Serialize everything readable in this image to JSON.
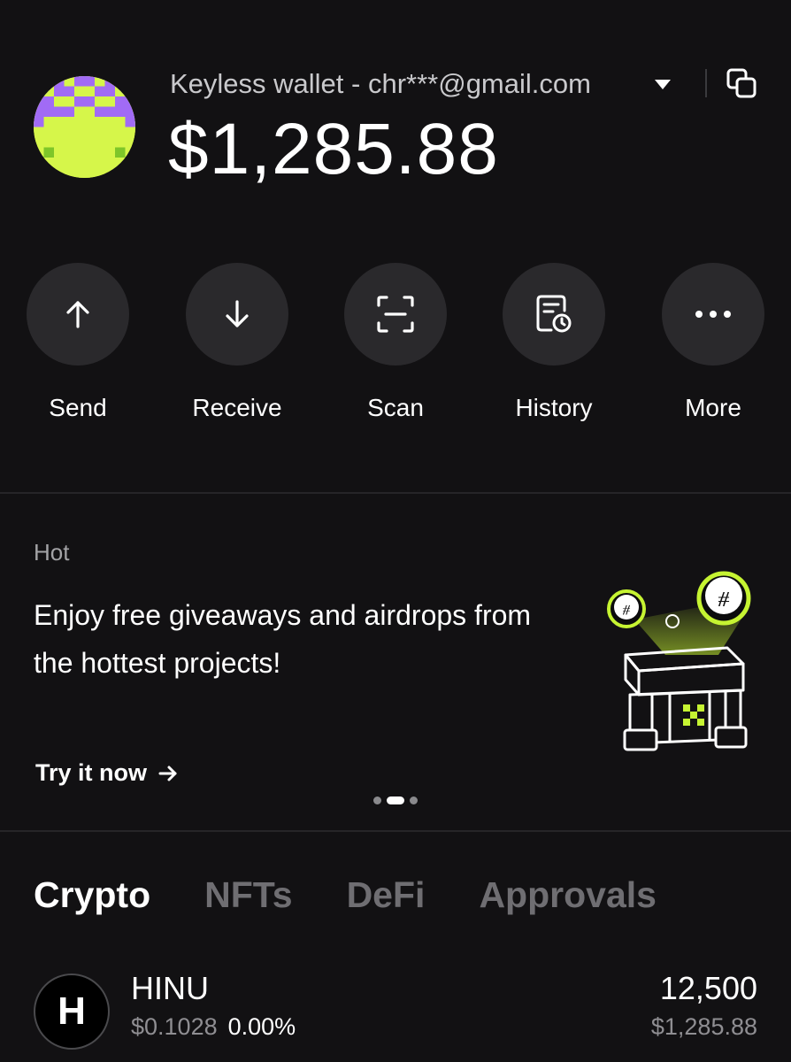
{
  "header": {
    "wallet_name": "Keyless wallet - chr***@gmail.com",
    "balance": "$1,285.88"
  },
  "actions": [
    {
      "label": "Send",
      "icon": "arrow-up-icon"
    },
    {
      "label": "Receive",
      "icon": "arrow-down-icon"
    },
    {
      "label": "Scan",
      "icon": "scan-icon"
    },
    {
      "label": "History",
      "icon": "history-icon"
    },
    {
      "label": "More",
      "icon": "more-icon"
    }
  ],
  "banner": {
    "tag": "Hot",
    "title": "Enjoy free giveaways and airdrops from the hottest projects!",
    "cta": "Try it now",
    "carousel_active_index": 2,
    "carousel_count": 3
  },
  "tabs": [
    {
      "label": "Crypto",
      "active": true
    },
    {
      "label": "NFTs",
      "active": false
    },
    {
      "label": "DeFi",
      "active": false
    },
    {
      "label": "Approvals",
      "active": false
    }
  ],
  "assets": [
    {
      "logo_letter": "H",
      "name": "HINU",
      "price": "$0.1028",
      "change": "0.00%",
      "amount": "12,500",
      "value": "$1,285.88"
    }
  ],
  "colors": {
    "background": "#121113",
    "button_bg": "#2a292c",
    "accent_green": "#c6f432",
    "avatar_purple": "#a16bf5",
    "muted_text": "#8f8e92"
  }
}
